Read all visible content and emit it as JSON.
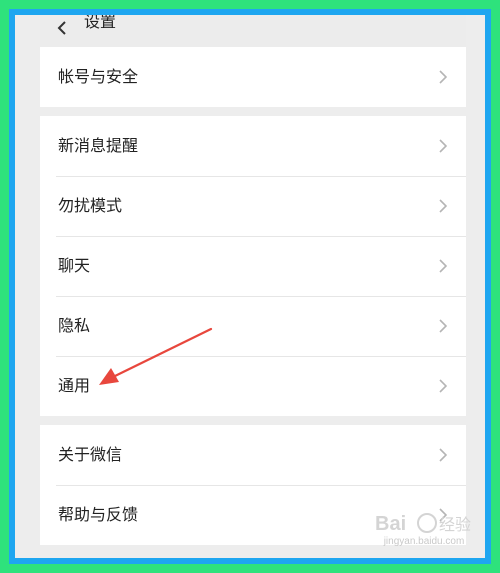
{
  "header": {
    "title": "设置"
  },
  "groups": [
    {
      "items": [
        {
          "label": "帐号与安全"
        }
      ]
    },
    {
      "items": [
        {
          "label": "新消息提醒"
        },
        {
          "label": "勿扰模式"
        },
        {
          "label": "聊天"
        },
        {
          "label": "隐私"
        },
        {
          "label": "通用"
        }
      ]
    },
    {
      "items": [
        {
          "label": "关于微信"
        },
        {
          "label": "帮助与反馈"
        }
      ]
    }
  ],
  "annotation": {
    "color": "#e8473d",
    "points_to": "通用"
  },
  "watermark": {
    "text": "jingyan.baidu.com"
  },
  "colors": {
    "frame_outer": "#2ee27c",
    "frame_inner": "#1ea6f0",
    "background": "#ededed"
  }
}
